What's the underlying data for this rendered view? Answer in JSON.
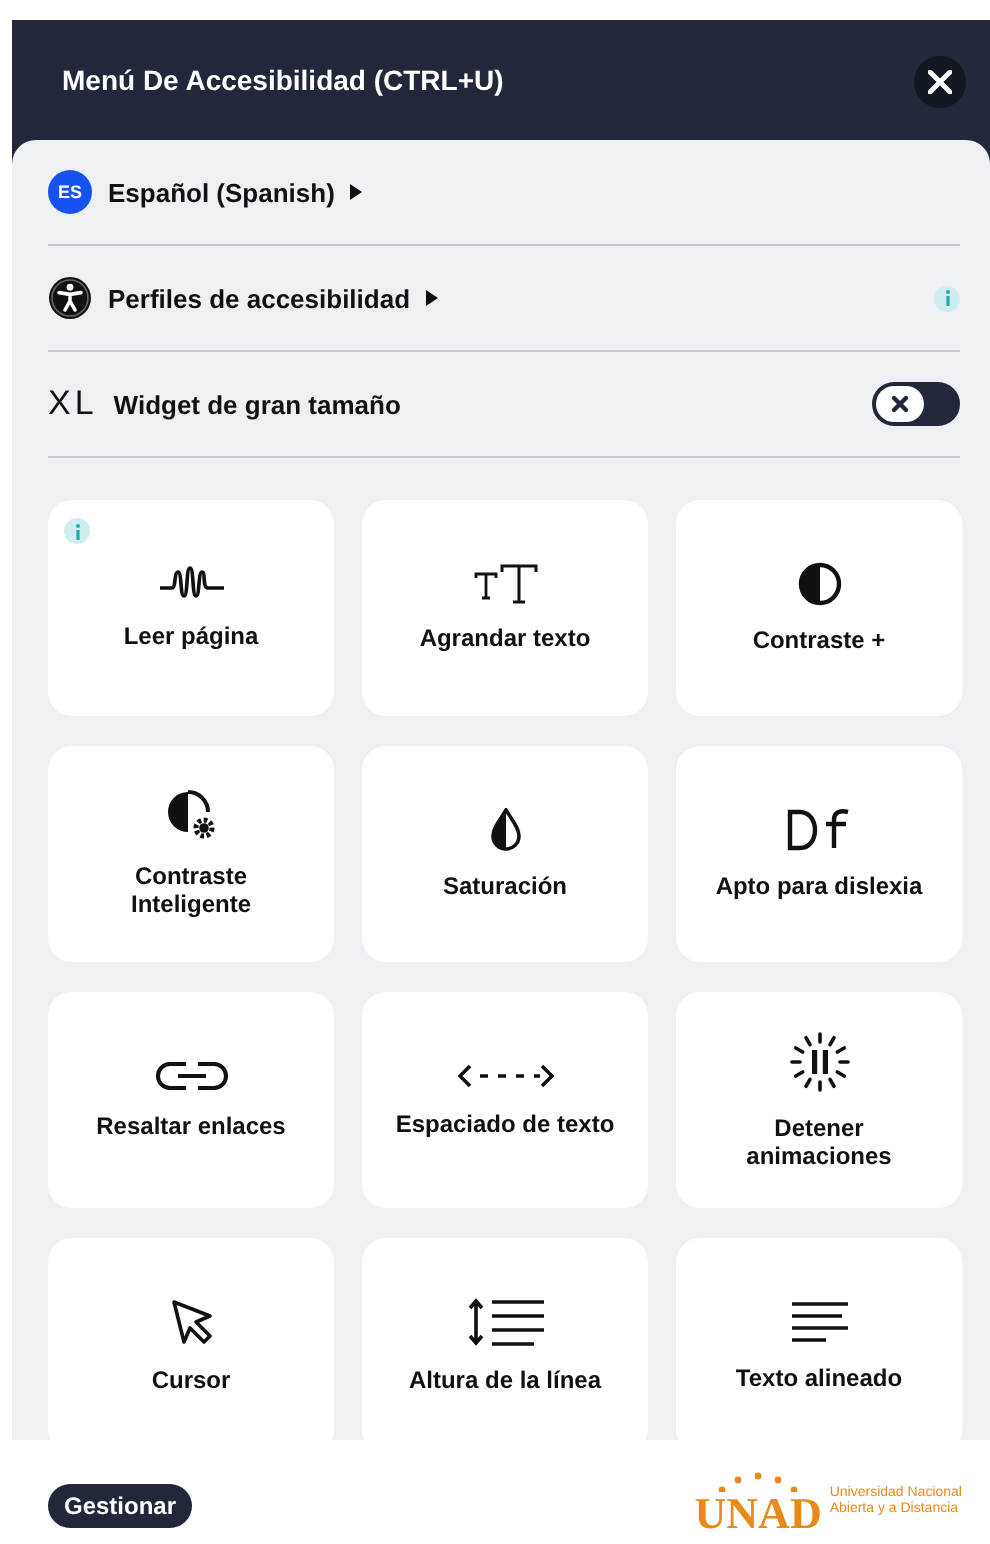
{
  "header": {
    "title": "Menú De Accesibilidad (CTRL+U)"
  },
  "settings": [
    {
      "kind": "language",
      "badge": "ES",
      "label": "Español (Spanish)",
      "submenu": true
    },
    {
      "kind": "profiles",
      "label": "Perfiles de accesibilidad",
      "submenu": true,
      "info": true
    },
    {
      "kind": "toggle",
      "prefix": "XL",
      "label": "Widget de gran tamaño",
      "on": false
    }
  ],
  "tiles": [
    {
      "kind": "read",
      "label": "Leer página",
      "info": true
    },
    {
      "kind": "text-size",
      "label": "Agrandar texto",
      "info": false
    },
    {
      "kind": "contrast",
      "label": "Contraste +",
      "info": false
    },
    {
      "kind": "smart-contrast",
      "label": "Contraste Inteligente",
      "info": false
    },
    {
      "kind": "saturation",
      "label": "Saturación",
      "info": false
    },
    {
      "kind": "dyslexia",
      "label": "Apto para dislexia",
      "info": false
    },
    {
      "kind": "links",
      "label": "Resaltar enlaces",
      "info": false
    },
    {
      "kind": "spacing",
      "label": "Espaciado de texto",
      "info": false
    },
    {
      "kind": "animations",
      "label": "Detener animaciones",
      "info": false
    },
    {
      "kind": "cursor",
      "label": "Cursor",
      "info": false
    },
    {
      "kind": "line-height",
      "label": "Altura de la línea",
      "info": false
    },
    {
      "kind": "align",
      "label": "Texto alineado",
      "info": false
    }
  ],
  "footer": {
    "button": "Gestionar",
    "logo": {
      "mark": "UNAD",
      "line_1": "Universidad Nacional",
      "line_2": "Abierta y a Distancia"
    }
  }
}
